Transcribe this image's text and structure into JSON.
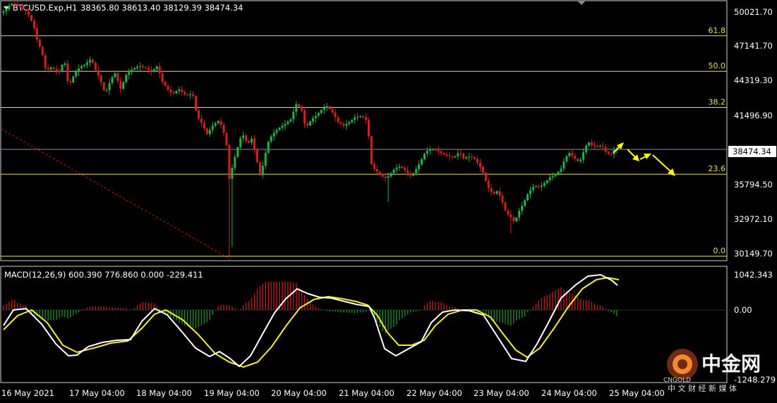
{
  "header": {
    "symbol": "BTCUSD.Exp,H1",
    "ohlc": "38365.80 38613.40 38129.39 38474.34"
  },
  "macd_header": "MACD(12,26,9) 600.390 776.860 0.000 -229.411",
  "price_axis": {
    "ticks": [
      "50021.70",
      "47141.70",
      "44319.30",
      "41496.90",
      "38474.34",
      "35794.50",
      "32972.10",
      "30149.70"
    ],
    "current_price": "38474.34"
  },
  "macd_axis": {
    "ticks": [
      "1042.343",
      "0.00",
      "-1248.279"
    ]
  },
  "fib_levels": [
    {
      "label": "61.8"
    },
    {
      "label": "50.0"
    },
    {
      "label": "38.2"
    },
    {
      "label": "23.6"
    },
    {
      "label": "0.0"
    }
  ],
  "time_axis": [
    "16 May 2021",
    "17 May 04:00",
    "18 May 04:00",
    "19 May 04:00",
    "20 May 04:00",
    "21 May 04:00",
    "22 May 04:00",
    "23 May 04:00",
    "24 May 04:00",
    "25 May 04:00"
  ],
  "watermark": {
    "name": "中金网",
    "en": "CNGOLD",
    "tagline": "中 文 财 经 新 媒 体"
  },
  "colors": {
    "background": "#000000",
    "up": "#22b14c",
    "down": "#d42020",
    "fib": "#e6e05a",
    "current_line": "#8a8ab0",
    "macd_line": "#ffffff",
    "signal_line": "#f2ee2a",
    "arrows": "#ffff00",
    "trend_line": "#c01818"
  },
  "chart_data": {
    "type": "candlestick",
    "title": "BTCUSD.Exp,H1",
    "unit": "USD",
    "ylim": [
      29500,
      50500
    ],
    "series_path": [
      [
        0,
        49600
      ],
      [
        8,
        49900
      ],
      [
        14,
        50400
      ],
      [
        22,
        50300
      ],
      [
        30,
        50000
      ],
      [
        38,
        49600
      ],
      [
        46,
        48700
      ],
      [
        52,
        47300
      ],
      [
        58,
        46500
      ],
      [
        64,
        44900
      ],
      [
        72,
        45200
      ],
      [
        82,
        44700
      ],
      [
        90,
        45800
      ],
      [
        96,
        43600
      ],
      [
        104,
        44600
      ],
      [
        112,
        45200
      ],
      [
        120,
        45400
      ],
      [
        128,
        45900
      ],
      [
        134,
        45000
      ],
      [
        140,
        44300
      ],
      [
        148,
        43000
      ],
      [
        156,
        44200
      ],
      [
        162,
        44700
      ],
      [
        170,
        43400
      ],
      [
        178,
        44600
      ],
      [
        186,
        45000
      ],
      [
        196,
        45300
      ],
      [
        206,
        45100
      ],
      [
        214,
        44800
      ],
      [
        222,
        45300
      ],
      [
        228,
        44100
      ],
      [
        236,
        43400
      ],
      [
        244,
        43000
      ],
      [
        252,
        43400
      ],
      [
        262,
        42900
      ],
      [
        272,
        43000
      ],
      [
        278,
        41200
      ],
      [
        286,
        40500
      ],
      [
        292,
        39700
      ],
      [
        300,
        40400
      ],
      [
        308,
        40800
      ],
      [
        314,
        40300
      ],
      [
        320,
        38800
      ],
      [
        324,
        36000
      ],
      [
        330,
        37500
      ],
      [
        336,
        38700
      ],
      [
        342,
        39800
      ],
      [
        350,
        38900
      ],
      [
        356,
        39400
      ],
      [
        362,
        37800
      ],
      [
        368,
        36200
      ],
      [
        374,
        37900
      ],
      [
        380,
        39300
      ],
      [
        388,
        39900
      ],
      [
        396,
        40300
      ],
      [
        404,
        40600
      ],
      [
        412,
        41000
      ],
      [
        418,
        42200
      ],
      [
        426,
        41800
      ],
      [
        432,
        40200
      ],
      [
        440,
        40900
      ],
      [
        448,
        41300
      ],
      [
        456,
        41800
      ],
      [
        462,
        42000
      ],
      [
        470,
        41500
      ],
      [
        478,
        40700
      ],
      [
        486,
        40400
      ],
      [
        494,
        40700
      ],
      [
        502,
        41100
      ],
      [
        512,
        41200
      ],
      [
        520,
        40700
      ],
      [
        524,
        37400
      ],
      [
        530,
        36800
      ],
      [
        536,
        36500
      ],
      [
        544,
        36100
      ],
      [
        550,
        36300
      ],
      [
        558,
        36900
      ],
      [
        566,
        37100
      ],
      [
        574,
        36700
      ],
      [
        580,
        36300
      ],
      [
        586,
        36600
      ],
      [
        594,
        37400
      ],
      [
        602,
        38300
      ],
      [
        610,
        38500
      ],
      [
        618,
        38400
      ],
      [
        626,
        38100
      ],
      [
        634,
        37900
      ],
      [
        642,
        37800
      ],
      [
        650,
        38300
      ],
      [
        656,
        37700
      ],
      [
        662,
        37900
      ],
      [
        670,
        37800
      ],
      [
        678,
        37200
      ],
      [
        684,
        36500
      ],
      [
        690,
        35400
      ],
      [
        698,
        34800
      ],
      [
        704,
        35100
      ],
      [
        710,
        34300
      ],
      [
        716,
        33300
      ],
      [
        722,
        33000
      ],
      [
        728,
        32500
      ],
      [
        734,
        33400
      ],
      [
        740,
        34000
      ],
      [
        748,
        35000
      ],
      [
        756,
        35500
      ],
      [
        764,
        35400
      ],
      [
        772,
        35800
      ],
      [
        778,
        36200
      ],
      [
        786,
        36400
      ],
      [
        794,
        36900
      ],
      [
        800,
        37800
      ],
      [
        806,
        38200
      ],
      [
        814,
        37700
      ],
      [
        820,
        37400
      ],
      [
        826,
        38300
      ],
      [
        832,
        39100
      ],
      [
        838,
        38800
      ],
      [
        846,
        38700
      ],
      [
        852,
        38800
      ],
      [
        858,
        38200
      ],
      [
        864,
        38000
      ],
      [
        870,
        38474
      ]
    ],
    "fibonacci": [
      {
        "label": "61.8",
        "value": 47750
      },
      {
        "label": "50.0",
        "value": 44850
      },
      {
        "label": "38.2",
        "value": 41900
      },
      {
        "label": "23.6",
        "value": 36450
      },
      {
        "label": "0.0",
        "value": 29750
      }
    ],
    "current_price": 38474.34,
    "macd": {
      "name": "MACD(12,26,9)",
      "values": [
        600.39,
        776.86,
        0.0,
        -229.411
      ],
      "ylim": [
        -1248.279,
        1042.343
      ]
    },
    "time_labels": [
      "16 May 2021",
      "17 May 04:00",
      "18 May 04:00",
      "19 May 04:00",
      "20 May 04:00",
      "21 May 04:00",
      "22 May 04:00",
      "23 May 04:00",
      "24 May 04:00",
      "25 May 04:00"
    ]
  }
}
